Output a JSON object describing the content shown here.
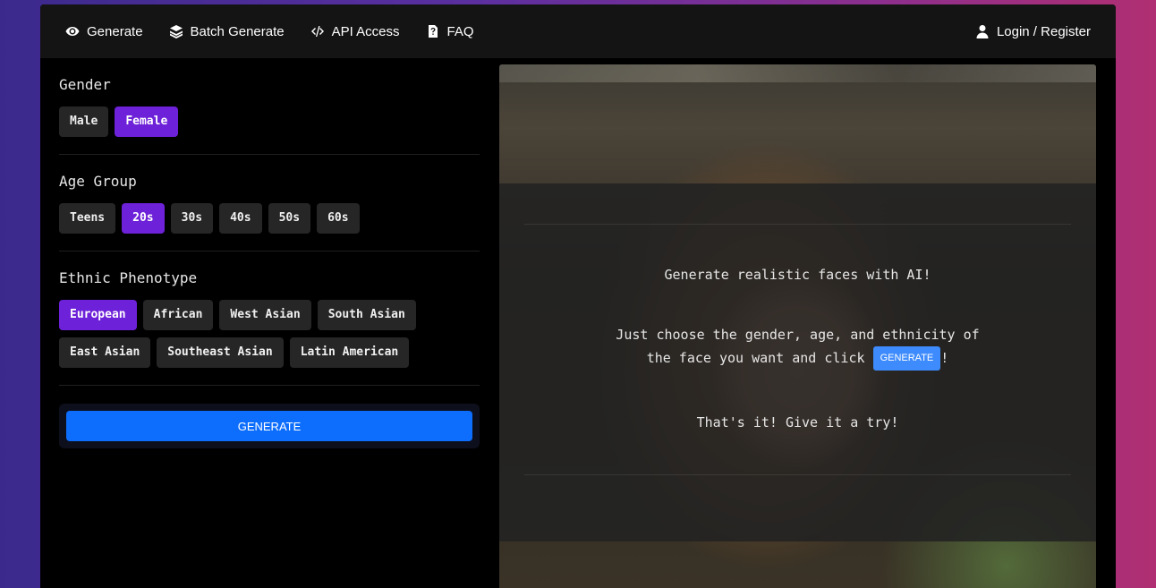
{
  "nav": {
    "items": [
      {
        "label": "Generate",
        "icon": "eye-icon"
      },
      {
        "label": "Batch Generate",
        "icon": "layers-icon"
      },
      {
        "label": "API Access",
        "icon": "code-icon"
      },
      {
        "label": "FAQ",
        "icon": "question-file-icon"
      }
    ],
    "login": {
      "label": "Login / Register",
      "icon": "user-icon"
    }
  },
  "gender": {
    "title": "Gender",
    "options": [
      {
        "label": "Male",
        "selected": false
      },
      {
        "label": "Female",
        "selected": true
      }
    ]
  },
  "age": {
    "title": "Age Group",
    "options": [
      {
        "label": "Teens",
        "selected": false
      },
      {
        "label": "20s",
        "selected": true
      },
      {
        "label": "30s",
        "selected": false
      },
      {
        "label": "40s",
        "selected": false
      },
      {
        "label": "50s",
        "selected": false
      },
      {
        "label": "60s",
        "selected": false
      }
    ]
  },
  "ethnicity": {
    "title": "Ethnic Phenotype",
    "options": [
      {
        "label": "European",
        "selected": true
      },
      {
        "label": "African",
        "selected": false
      },
      {
        "label": "West Asian",
        "selected": false
      },
      {
        "label": "South Asian",
        "selected": false
      },
      {
        "label": "East Asian",
        "selected": false
      },
      {
        "label": "Southeast Asian",
        "selected": false
      },
      {
        "label": "Latin American",
        "selected": false
      }
    ]
  },
  "generate_label": "GENERATE",
  "overlay": {
    "line1": "Generate realistic faces with AI!",
    "line2a": "Just choose the gender, age, and ethnicity of",
    "line2b": "the face you want and click",
    "button": "GENERATE",
    "line2c": "!",
    "line3": "That's it! Give it a try!"
  },
  "colors": {
    "accent_purple": "#6d21d8",
    "primary_blue": "#0d6efd",
    "inline_blue": "#3d8bfd"
  }
}
